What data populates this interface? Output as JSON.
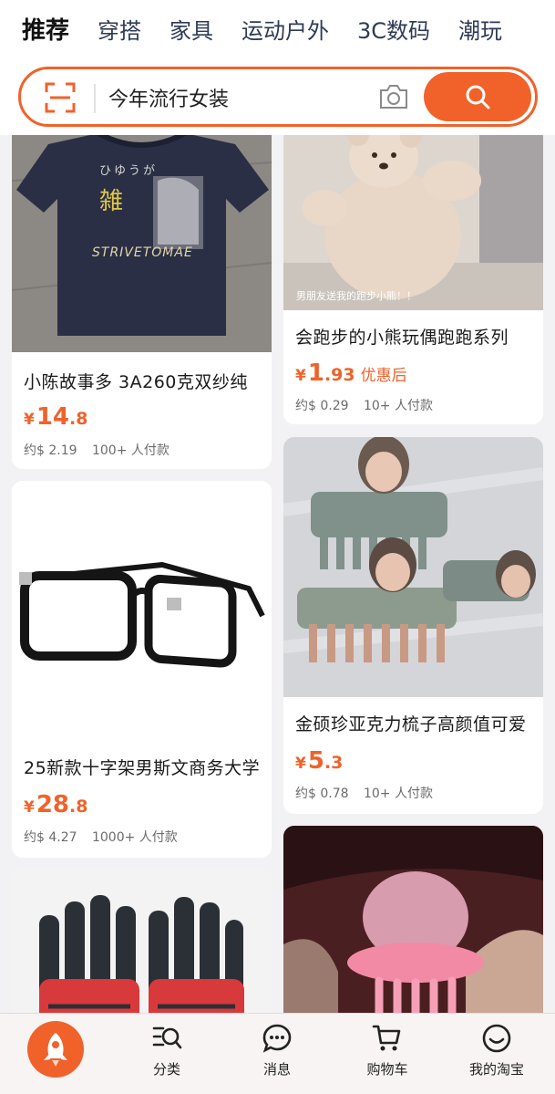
{
  "tabs": [
    {
      "label": "推荐",
      "active": true
    },
    {
      "label": "穿搭"
    },
    {
      "label": "家具"
    },
    {
      "label": "运动户外"
    },
    {
      "label": "3C数码"
    },
    {
      "label": "潮玩"
    }
  ],
  "search": {
    "value": "今年流行女装"
  },
  "colors": {
    "accent": "#f0622a"
  },
  "products": [
    {
      "title": "小陈故事多 3A260克双纱纯",
      "price_int": "14",
      "price_dec": ".8",
      "price_tag": "",
      "approx": "约$ 2.19",
      "buyers": "100+ 人付款"
    },
    {
      "title": "会跑步的小熊玩偶跑跑系列",
      "price_int": "1",
      "price_dec": ".93",
      "price_tag": "优惠后",
      "approx": "约$ 0.29",
      "buyers": "10+ 人付款",
      "image_caption": "男朋友送我的跑步小熊！！"
    },
    {
      "title": "25新款十字架男斯文商务大学",
      "price_int": "28",
      "price_dec": ".8",
      "price_tag": "",
      "approx": "约$ 4.27",
      "buyers": "1000+ 人付款"
    },
    {
      "title": "金硕珍亚克力梳子高颜值可爱",
      "price_int": "5",
      "price_dec": ".3",
      "price_tag": "",
      "approx": "约$ 0.78",
      "buyers": "10+ 人付款"
    }
  ],
  "price_symbol": "¥",
  "tshirt_print": {
    "kana": "ひゆうが",
    "kanji": "雑",
    "brand": "STRIVETOMAE"
  },
  "nav": [
    {
      "label": "",
      "icon": "rocket-icon"
    },
    {
      "label": "分类",
      "icon": "category-search-icon"
    },
    {
      "label": "消息",
      "icon": "message-icon"
    },
    {
      "label": "购物车",
      "icon": "cart-icon"
    },
    {
      "label": "我的淘宝",
      "icon": "smile-icon"
    }
  ]
}
